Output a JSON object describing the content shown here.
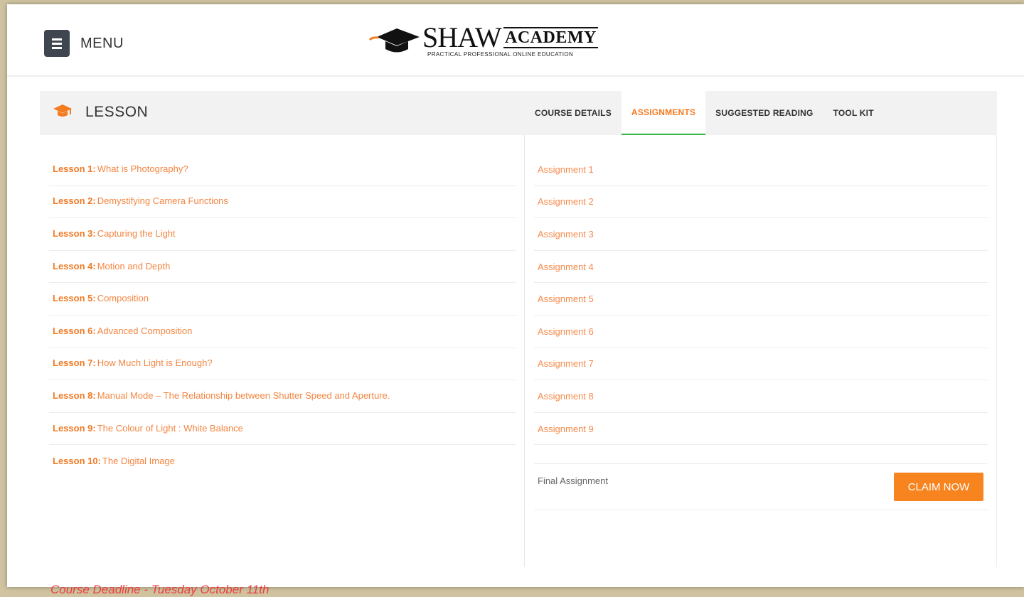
{
  "header": {
    "menu_label": "MENU",
    "menu_icon": "hamburger-icon",
    "logo": {
      "name_main": "SHAW",
      "name_sub": "ACADEMY",
      "tagline": "PRACTICAL PROFESSIONAL ONLINE EDUCATION",
      "icon": "graduation-cap-icon"
    }
  },
  "panel": {
    "title": "LESSON",
    "icon": "graduation-cap-icon",
    "tabs": [
      {
        "label": "COURSE DETAILS",
        "active": false
      },
      {
        "label": "ASSIGNMENTS",
        "active": true
      },
      {
        "label": "SUGGESTED READING",
        "active": false
      },
      {
        "label": "TOOL KIT",
        "active": false
      }
    ],
    "lessons": [
      {
        "num": "Lesson 1:",
        "title": "What is Photography?"
      },
      {
        "num": "Lesson 2:",
        "title": "Demystifying Camera Functions"
      },
      {
        "num": "Lesson 3:",
        "title": "Capturing the Light"
      },
      {
        "num": "Lesson 4:",
        "title": "Motion and Depth"
      },
      {
        "num": "Lesson 5:",
        "title": "Composition"
      },
      {
        "num": "Lesson 6:",
        "title": "Advanced Composition"
      },
      {
        "num": "Lesson 7:",
        "title": "How Much Light is Enough?"
      },
      {
        "num": "Lesson 8:",
        "title": "Manual Mode – The Relationship between Shutter Speed and Aperture."
      },
      {
        "num": "Lesson 9:",
        "title": "The Colour of Light : White Balance"
      },
      {
        "num": "Lesson 10:",
        "title": "The Digital Image"
      }
    ],
    "deadline": "Course Deadline - Tuesday October 11th",
    "assignments": [
      "Assignment 1",
      "Assignment 2",
      "Assignment 3",
      "Assignment 4",
      "Assignment 5",
      "Assignment 6",
      "Assignment 7",
      "Assignment 8",
      "Assignment 9"
    ],
    "final_assignment": {
      "label": "Final Assignment",
      "button": "CLAIM NOW"
    }
  },
  "colors": {
    "accent": "#f47b20",
    "active_tab_underline": "#3ab54a",
    "deadline": "#ee3d3d",
    "menu_button": "#3f4650"
  }
}
